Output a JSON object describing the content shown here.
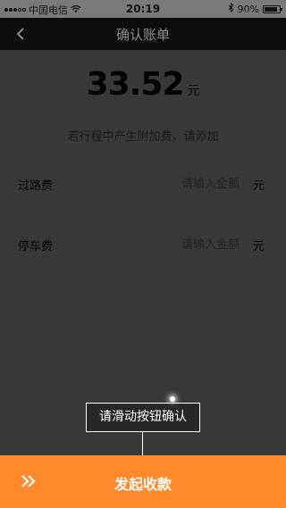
{
  "status_bar": {
    "carrier": "中国电信",
    "time": "20:19",
    "battery_text": "90%",
    "battery_level": 0.9
  },
  "nav": {
    "title": "确认账单",
    "back_icon": "chevron-left-icon"
  },
  "amount": {
    "value": "33.52",
    "unit": "元"
  },
  "hint": "若行程中产生附加费，请添加",
  "fees": [
    {
      "label": "过路费",
      "placeholder": "请输入金额",
      "unit": "元"
    },
    {
      "label": "停车费",
      "placeholder": "请输入金额",
      "unit": "元"
    }
  ],
  "tooltip": "请滑动按钮确认",
  "bottom": {
    "slide_icon": "double-chevron-right-icon",
    "label": "发起收款",
    "color": "#ff8a2b"
  }
}
